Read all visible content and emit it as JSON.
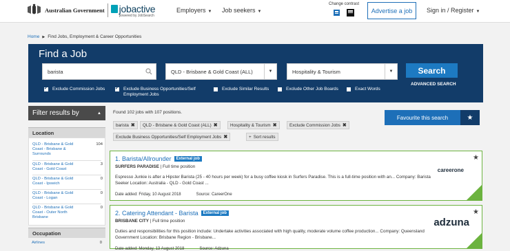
{
  "header": {
    "gov_text": "Australian Government",
    "brand": "jobactive",
    "brand_sub": "powered by JobSearch",
    "nav": [
      "Employers",
      "Job seekers"
    ],
    "contrast_label": "Change contrast",
    "advertise": "Advertise a job",
    "signin": "Sign in / Register"
  },
  "breadcrumb": {
    "home": "Home",
    "current": "Find Jobs, Employment & Career Opportunities"
  },
  "find": {
    "title": "Find a Job",
    "keyword": "barista",
    "location": "QLD - Brisbane & Gold Coast (ALL)",
    "category": "Hospitality & Tourism",
    "search": "Search",
    "advanced": "ADVANCED SEARCH",
    "checks": [
      {
        "label": "Exclude Commission Jobs",
        "checked": true
      },
      {
        "label": "Exclude Business Opportunities/Self Employment Jobs",
        "checked": true
      },
      {
        "label": "Exclude Similar Results",
        "checked": false
      },
      {
        "label": "Exclude Other Job Boards",
        "checked": false
      },
      {
        "label": "Exact Words",
        "checked": false
      }
    ]
  },
  "filters": {
    "title": "Filter results by",
    "location_head": "Location",
    "occupation_head": "Occupation",
    "locations": [
      {
        "label": "QLD - Brisbane & Gold Coast - Brisbane & Surrounds",
        "count": "104"
      },
      {
        "label": "QLD - Brisbane & Gold Coast - Gold Coast",
        "count": "3"
      },
      {
        "label": "QLD - Brisbane & Gold Coast - Ipswich",
        "count": "0"
      },
      {
        "label": "QLD - Brisbane & Gold Coast - Logan",
        "count": "0"
      },
      {
        "label": "QLD - Brisbane & Gold Coast - Outer North Brisbane",
        "count": "0"
      }
    ],
    "occupations": [
      {
        "label": "Airlines",
        "count": "0"
      }
    ]
  },
  "results": {
    "found": "Found 102 jobs with 107 positions.",
    "chips": [
      "barista",
      "QLD - Brisbane & Gold Coast (ALL)",
      "Hospitality & Tourism",
      "Exclude Commission Jobs",
      "Exclude Business Opportunities/Self Employment Jobs"
    ],
    "sort": "Sort results",
    "favourite": "Favourite this search",
    "jobs": [
      {
        "title": "1. Barista/Allrounder",
        "badge": "External job",
        "location": "SURFERS PARADISE",
        "type": " | Full time position",
        "desc": "Espresso Junkie is after a Hipster Barista (25 - 40 hours per week) for a busy coffee kiosk in Surfers Paradise. This is a full-time position with an... Company: Barista Seeker Location: Australia - QLD - Gold Coast ...",
        "date": "Date added: Friday, 10 August 2018",
        "source": "Source: CareerOne",
        "logo": "careerone"
      },
      {
        "title": "2. Catering Attendant - Barista",
        "badge": "External job",
        "location": "BRISBANE CITY",
        "type": " | Full time position",
        "desc": "Duties and responsibilities for this position include: Undertake activities associated with high quality, moderate volume coffee production... Company: Queensland Government Location: Brisbane Region - Brisbane...",
        "date": "Date added: Monday, 13 August 2018",
        "source": "Source: Adzuna",
        "logo": "adzuna"
      }
    ]
  },
  "colors": {
    "navy": "#123c69",
    "blue": "#1d6fb8",
    "green": "#6cb33f"
  }
}
